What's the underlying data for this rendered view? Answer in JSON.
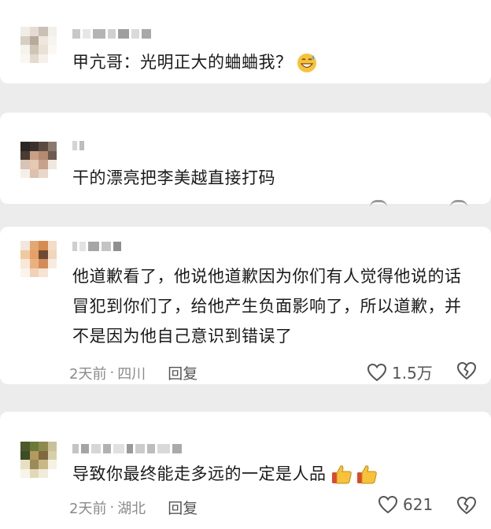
{
  "comments": [
    {
      "text": "甲亢哥：光明正大的蛐蛐我？",
      "emoji": "grinning-sweat-emoji"
    },
    {
      "text": "干的漂亮把李美越直接打码"
    },
    {
      "text": "他道歉看了，他说他道歉因为你们有人觉得他说的话冒犯到你们了，给他产生负面影响了，所以道歉，并不是因为他自己意识到错误了",
      "time": "2天前",
      "location": "四川",
      "reply_label": "回复",
      "likes": "1.5万"
    },
    {
      "text": "导致你最终能走多远的一定是人品",
      "emoji": "thumbs-up-emoji",
      "time": "2天前",
      "location": "湖北",
      "reply_label": "回复",
      "likes": "621"
    }
  ],
  "meta_separator": "·",
  "colors": {
    "background": "#ececec",
    "card": "#ffffff",
    "text": "#1a1a1a",
    "meta": "#8a8a8a"
  }
}
